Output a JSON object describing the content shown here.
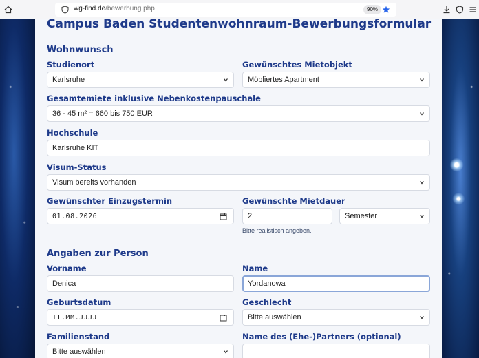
{
  "browser": {
    "url_domain": "wg-find.de",
    "url_path": "/bewerbung.php",
    "zoom": "90%"
  },
  "form": {
    "title": "Campus Baden Studentenwohnraum-Bewerbungsformular",
    "section1": {
      "title": "Wohnwunsch",
      "studienort": {
        "label": "Studienort",
        "value": "Karlsruhe"
      },
      "mietobjekt": {
        "label": "Gewünschtes Mietobjekt",
        "value": "Möbliertes Apartment"
      },
      "gesamtmiete": {
        "label": "Gesamtemiete inklusive Nebenkostenpauschale",
        "value": "36 - 45 m² = 660 bis 750 EUR"
      },
      "hochschule": {
        "label": "Hochschule",
        "value": "Karlsruhe KIT"
      },
      "visum": {
        "label": "Visum-Status",
        "value": "Visum bereits vorhanden"
      },
      "einzug": {
        "label": "Gewünschter Einzugstermin",
        "value": "01.08.2026"
      },
      "mietdauer": {
        "label": "Gewünschte Mietdauer",
        "value": "2",
        "unit": "Semester",
        "hint": "Bitte realistisch angeben."
      }
    },
    "section2": {
      "title": "Angaben zur Person",
      "vorname": {
        "label": "Vorname",
        "value": "Denica"
      },
      "name": {
        "label": "Name",
        "value": "Yordanowa"
      },
      "geburtsdatum": {
        "label": "Geburtsdatum",
        "value": "TT.MM.JJJJ"
      },
      "geschlecht": {
        "label": "Geschlecht",
        "value": "Bitte auswählen"
      },
      "familienstand": {
        "label": "Familienstand",
        "value": "Bitte auswählen"
      },
      "partner": {
        "label": "Name des (Ehe-)Partners (optional)",
        "value": ""
      }
    }
  },
  "colors": {
    "heading": "#1e3a8a",
    "panel_bg": "#f4f6fa",
    "star": "#2563eb"
  }
}
